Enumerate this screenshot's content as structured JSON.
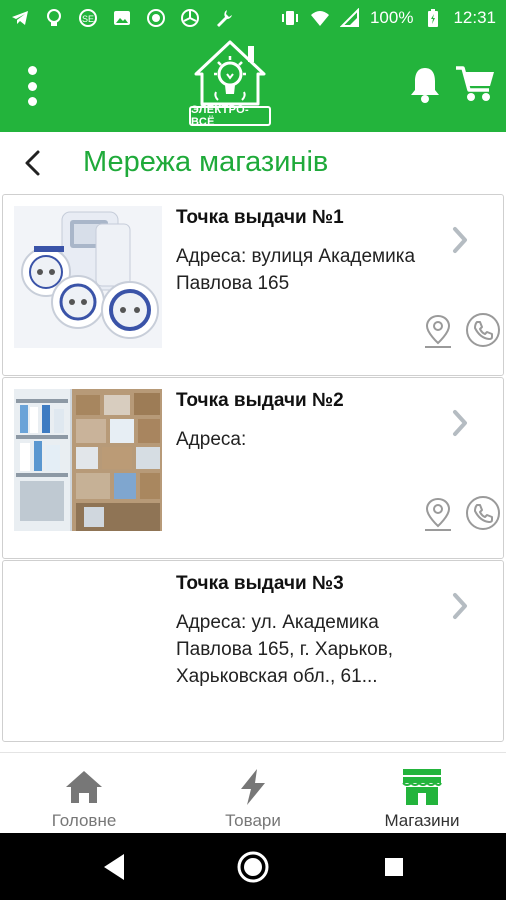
{
  "status_bar": {
    "battery": "100%",
    "time": "12:31"
  },
  "app_bar": {
    "logo_text": "ЭЛЕКТРО-ВСЁ",
    "icons": [
      "menu-icon",
      "bulb-house-logo",
      "bell-icon",
      "cart-icon"
    ],
    "accent_color": "#23b43c"
  },
  "page": {
    "title": "Мережа магазинів"
  },
  "stores": [
    {
      "title": "Точка выдачи №1",
      "address": "Адреса: вулиця Академика Павлова 165"
    },
    {
      "title": "Точка выдачи №2",
      "address": "Адреса:"
    },
    {
      "title": "Точка выдачи №3",
      "address": "Адреса: ул. Академика Павлова 165, г. Харьков, Харьковская обл., 61..."
    }
  ],
  "bottom_nav": {
    "home": "Головне",
    "goods": "Товари",
    "shops": "Магазини",
    "active": "shops"
  }
}
